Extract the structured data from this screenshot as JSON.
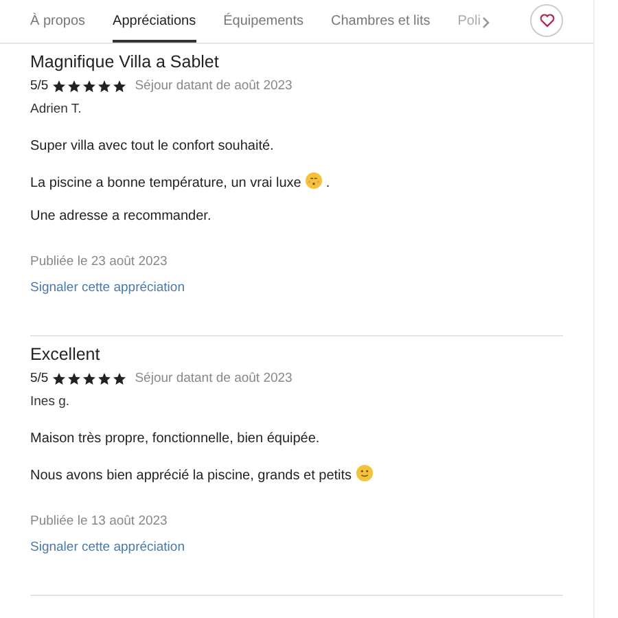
{
  "tabs": [
    {
      "label": "À propos",
      "selected": false
    },
    {
      "label": "Appréciations",
      "selected": true
    },
    {
      "label": "Équipements",
      "selected": false
    },
    {
      "label": "Chambres et lits",
      "selected": false
    },
    {
      "label": "Poli",
      "selected": false
    }
  ],
  "favorite": {
    "on": false
  },
  "reviews": [
    {
      "title": "Magnifique Villa a Sablet",
      "score": "5/5",
      "stars": 5,
      "stay": "Séjour datant de août 2023",
      "author": "Adrien T.",
      "paragraphs": [
        {
          "text": "Super villa avec tout le confort souhaité."
        },
        {
          "text": "La piscine a bonne température, un vrai luxe",
          "kind": "kiss",
          "after": "."
        },
        {
          "text": "Une adresse a recommander."
        }
      ],
      "published": "Publiée le 23 août 2023",
      "report": "Signaler cette appréciation"
    },
    {
      "title": "Excellent",
      "score": "5/5",
      "stars": 5,
      "stay": "Séjour datant de août 2023",
      "author": "Ines g.",
      "paragraphs": [
        {
          "text": "Maison très propre, fonctionnelle, bien équipée."
        },
        {
          "text": "Nous avons bien apprécié la piscine, grands et petits",
          "kind": "smile"
        }
      ],
      "published": "Publiée le 13 août 2023",
      "report": "Signaler cette appréciation"
    }
  ]
}
